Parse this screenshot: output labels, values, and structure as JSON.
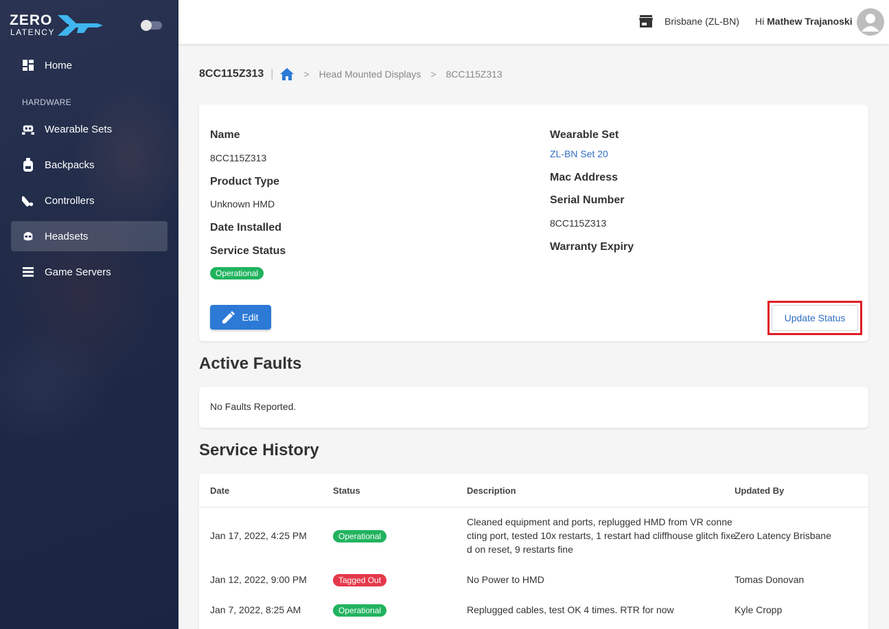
{
  "app": {
    "brand_top": "ZERO",
    "brand_bottom": "LATENCY",
    "colors": {
      "sidebar": "#1f2a47",
      "accent": "#2c7ad6",
      "operational": "#21b35f",
      "tagged_out": "#e5394b",
      "highlight": "#e01b24"
    }
  },
  "sidebar": {
    "section_header": "HARDWARE",
    "items": [
      {
        "label": "Home",
        "icon": "dashboard-icon"
      },
      {
        "label": "Wearable Sets",
        "icon": "vr-set-icon"
      },
      {
        "label": "Backpacks",
        "icon": "backpack-icon"
      },
      {
        "label": "Controllers",
        "icon": "controller-icon"
      },
      {
        "label": "Headsets",
        "icon": "headset-icon",
        "active": true
      },
      {
        "label": "Game Servers",
        "icon": "server-icon"
      }
    ]
  },
  "header": {
    "location": "Brisbane (ZL-BN)",
    "greeting_prefix": "Hi",
    "user_name": "Mathew Trajanoski"
  },
  "breadcrumb": {
    "title": "8CC115Z313",
    "sep": "|",
    "chevron": ">",
    "items": [
      "Head Mounted Displays",
      "8CC115Z313"
    ]
  },
  "details": {
    "name_label": "Name",
    "name_value": "8CC115Z313",
    "product_type_label": "Product Type",
    "product_type_value": "Unknown HMD",
    "date_installed_label": "Date Installed",
    "service_status_label": "Service Status",
    "service_status_value": "Operational",
    "wearable_set_label": "Wearable Set",
    "wearable_set_value": "ZL-BN Set 20",
    "mac_label": "Mac Address",
    "serial_label": "Serial Number",
    "serial_value": "8CC115Z313",
    "warranty_label": "Warranty Expiry",
    "edit_label": "Edit",
    "update_label": "Update Status"
  },
  "faults": {
    "title": "Active Faults",
    "message": "No Faults Reported."
  },
  "history": {
    "title": "Service History",
    "columns": [
      "Date",
      "Status",
      "Description",
      "Updated By"
    ],
    "rows": [
      {
        "date": "Jan 17, 2022, 4:25 PM",
        "status": "Operational",
        "description": "Cleaned equipment and ports, replugged HMD from VR connecting port, tested 10x restarts, 1 restart had cliffhouse glitch fixed on reset, 9 restarts fine",
        "updated_by": "Zero Latency Brisbane"
      },
      {
        "date": "Jan 12, 2022, 9:00 PM",
        "status": "Tagged Out",
        "description": "No Power to HMD",
        "updated_by": "Tomas Donovan"
      },
      {
        "date": "Jan 7, 2022, 8:25 AM",
        "status": "Operational",
        "description": "Replugged cables, test OK 4 times. RTR for now",
        "updated_by": "Kyle Cropp"
      }
    ]
  }
}
